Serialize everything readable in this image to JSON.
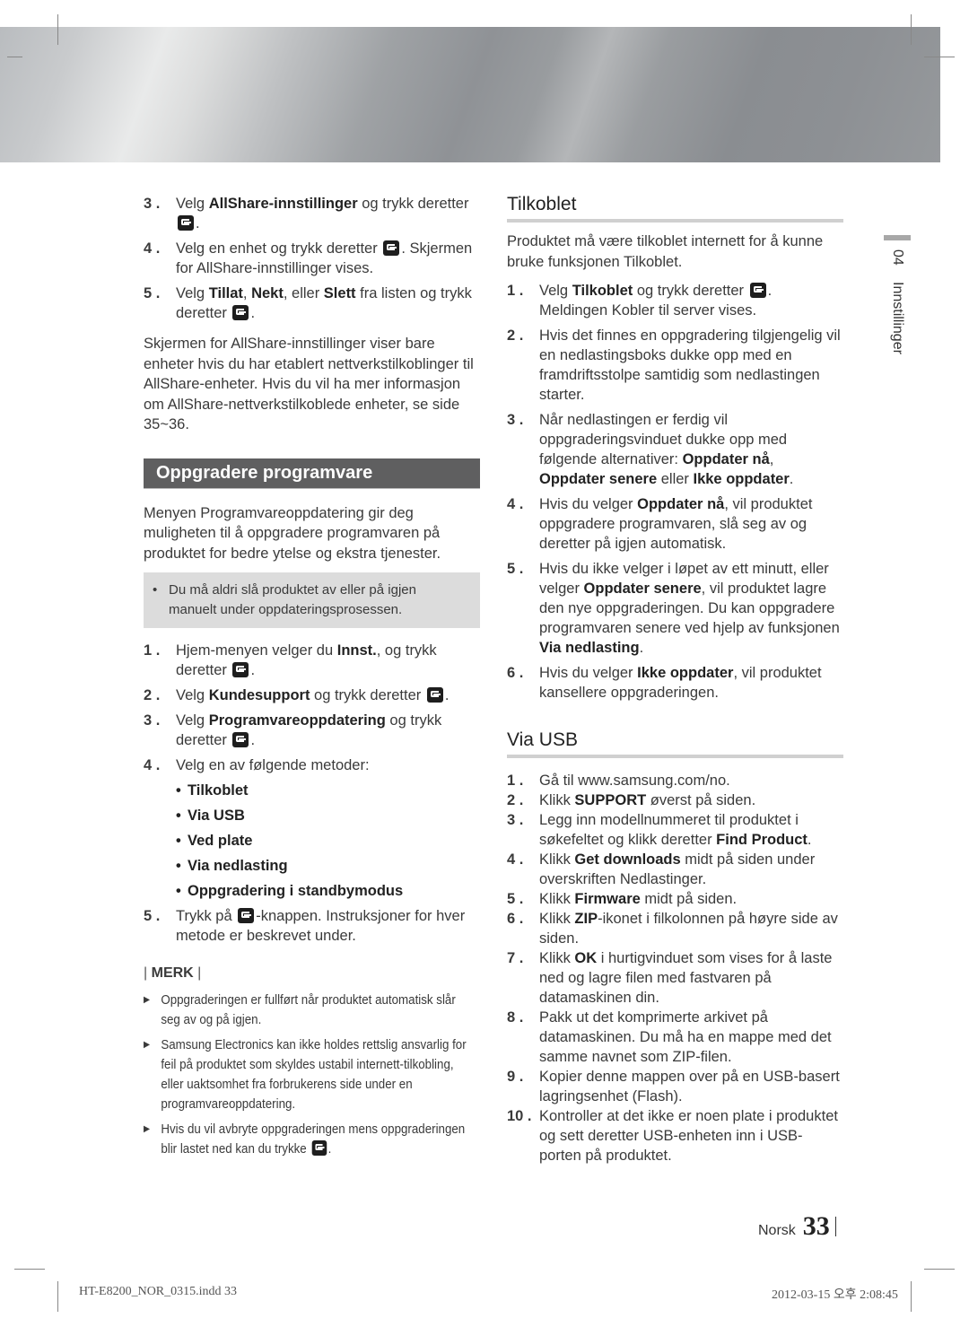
{
  "header": {
    "banner": "silver-gradient-banner"
  },
  "left_column": {
    "intro_steps": [
      {
        "num": "3 .",
        "parts": [
          {
            "t": "Velg "
          },
          {
            "b": "AllShare-innstillinger"
          },
          {
            "t": " og trykk deretter "
          },
          {
            "icon": "enter"
          },
          {
            "t": "."
          }
        ]
      },
      {
        "num": "4 .",
        "parts": [
          {
            "t": "Velg en enhet og trykk deretter "
          },
          {
            "icon": "enter"
          },
          {
            "t": ". Skjermen for AllShare-innstillinger vises."
          }
        ]
      },
      {
        "num": "5 .",
        "parts": [
          {
            "t": "Velg "
          },
          {
            "b": "Tillat"
          },
          {
            "t": ", "
          },
          {
            "b": "Nekt"
          },
          {
            "t": ", eller "
          },
          {
            "b": "Slett"
          },
          {
            "t": "  fra listen og trykk deretter "
          },
          {
            "icon": "enter"
          },
          {
            "t": "."
          }
        ]
      }
    ],
    "allshare_note": "Skjermen for AllShare-innstillinger viser bare enheter hvis du har etablert nettverkstilkoblinger til AllShare-enheter. Hvis du vil ha mer informasjon om AllShare-nettverkstilkoblede enheter, se side 35~36.",
    "section_title": "Oppgradere programvare",
    "section_intro": "Menyen Programvareoppdatering gir deg muligheten til å oppgradere programvaren på produktet for bedre ytelse og ekstra tjenester.",
    "warning": "Du må aldri slå produktet av eller på igjen manuelt under oppdateringsprosessen.",
    "steps": [
      {
        "num": "1 .",
        "parts": [
          {
            "t": "Hjem-menyen velger du "
          },
          {
            "b": "Innst."
          },
          {
            "t": ", og trykk deretter "
          },
          {
            "icon": "enter"
          },
          {
            "t": "."
          }
        ]
      },
      {
        "num": "2 .",
        "parts": [
          {
            "t": "Velg "
          },
          {
            "b": "Kundesupport"
          },
          {
            "t": " og trykk deretter "
          },
          {
            "icon": "enter"
          },
          {
            "t": "."
          }
        ]
      },
      {
        "num": "3 .",
        "parts": [
          {
            "t": "Velg "
          },
          {
            "b": "Programvareoppdatering"
          },
          {
            "t": " og trykk deretter "
          },
          {
            "icon": "enter"
          },
          {
            "t": "."
          }
        ]
      },
      {
        "num": "4 .",
        "parts": [
          {
            "t": "Velg en av følgende metoder:"
          }
        ]
      }
    ],
    "methods": [
      "Tilkoblet",
      "Via USB",
      "Ved plate",
      "Via nedlasting",
      "Oppgradering i standbymodus"
    ],
    "step5": {
      "num": "5 .",
      "parts": [
        {
          "t": "Trykk på "
        },
        {
          "icon": "enter"
        },
        {
          "t": "-knappen. Instruksjoner for hver metode er beskrevet under."
        }
      ]
    },
    "merk_label": "MERK",
    "notes": [
      [
        {
          "t": "Oppgraderingen er fullført når produktet automatisk slår seg av og på igjen."
        }
      ],
      [
        {
          "t": "Samsung Electronics kan ikke holdes rettslig ansvarlig for feil på produktet som skyldes ustabil internett-tilkobling, eller uaktsomhet fra forbrukerens side under en programvareoppdatering."
        }
      ],
      [
        {
          "t": "Hvis du vil avbryte oppgraderingen mens oppgraderingen blir lastet ned kan du trykke "
        },
        {
          "icon": "enter"
        },
        {
          "t": "."
        }
      ]
    ]
  },
  "right_column": {
    "tilkoblet": {
      "title": "Tilkoblet",
      "intro": "Produktet må være tilkoblet internett for å kunne bruke funksjonen Tilkoblet.",
      "steps": [
        {
          "num": "1 .",
          "parts": [
            {
              "t": "Velg "
            },
            {
              "b": "Tilkoblet"
            },
            {
              "t": " og trykk deretter "
            },
            {
              "icon": "enter"
            },
            {
              "t": ". Meldingen Kobler til server vises."
            }
          ]
        },
        {
          "num": "2 .",
          "parts": [
            {
              "t": "Hvis det finnes en oppgradering tilgjengelig vil en nedlastingsboks dukke opp med en framdriftsstolpe samtidig som nedlastingen starter."
            }
          ]
        },
        {
          "num": "3 .",
          "parts": [
            {
              "t": "Når nedlastingen er ferdig vil oppgraderingsvinduet dukke opp med følgende alternativer: "
            },
            {
              "b": "Oppdater nå"
            },
            {
              "t": ", "
            },
            {
              "b": "Oppdater senere"
            },
            {
              "t": " eller "
            },
            {
              "b": "Ikke oppdater"
            },
            {
              "t": "."
            }
          ]
        },
        {
          "num": "4 .",
          "parts": [
            {
              "t": "Hvis du velger "
            },
            {
              "b": "Oppdater nå"
            },
            {
              "t": ", vil produktet oppgradere programvaren, slå seg av og deretter på igjen automatisk."
            }
          ]
        },
        {
          "num": "5 .",
          "parts": [
            {
              "t": "Hvis du ikke velger i løpet av ett minutt, eller velger "
            },
            {
              "b": "Oppdater senere"
            },
            {
              "t": ", vil produktet lagre den nye oppgraderingen. Du kan oppgradere programvaren senere ved hjelp av funksjonen "
            },
            {
              "b": "Via nedlasting"
            },
            {
              "t": "."
            }
          ]
        },
        {
          "num": "6 .",
          "parts": [
            {
              "t": "Hvis du velger "
            },
            {
              "b": "Ikke oppdater"
            },
            {
              "t": ", vil produktet kansellere oppgraderingen."
            }
          ]
        }
      ]
    },
    "via_usb": {
      "title": "Via USB",
      "steps": [
        {
          "num": "1 .",
          "parts": [
            {
              "t": "Gå til www.samsung.com/no."
            }
          ]
        },
        {
          "num": "2 .",
          "parts": [
            {
              "t": "Klikk "
            },
            {
              "b": "SUPPORT"
            },
            {
              "t": " øverst på siden."
            }
          ]
        },
        {
          "num": "3 .",
          "parts": [
            {
              "t": "Legg inn modellnummeret til produktet i søkefeltet og klikk deretter "
            },
            {
              "b": "Find Product"
            },
            {
              "t": "."
            }
          ]
        },
        {
          "num": "4 .",
          "parts": [
            {
              "t": "Klikk "
            },
            {
              "b": "Get downloads"
            },
            {
              "t": " midt på siden under overskriften Nedlastinger."
            }
          ]
        },
        {
          "num": "5 .",
          "parts": [
            {
              "t": "Klikk "
            },
            {
              "b": "Firmware"
            },
            {
              "t": " midt på siden."
            }
          ]
        },
        {
          "num": "6 .",
          "parts": [
            {
              "t": "Klikk "
            },
            {
              "b": "ZIP"
            },
            {
              "t": "-ikonet i filkolonnen på høyre side av siden."
            }
          ]
        },
        {
          "num": "7 .",
          "parts": [
            {
              "t": "Klikk "
            },
            {
              "b": "OK"
            },
            {
              "t": " i hurtigvinduet som vises for å laste ned og lagre filen med fastvaren på datamaskinen din."
            }
          ]
        },
        {
          "num": "8 .",
          "parts": [
            {
              "t": "Pakk ut det komprimerte arkivet på datamaskinen. Du må ha en mappe med det samme navnet som ZIP-filen."
            }
          ]
        },
        {
          "num": "9 .",
          "parts": [
            {
              "t": " Kopier denne mappen over på en USB-basert lagringsenhet (Flash)."
            }
          ]
        },
        {
          "num": "10 .",
          "parts": [
            {
              "t": "Kontroller at det ikke er noen plate i produktet og sett deretter USB-enheten inn i USB-porten på produktet."
            }
          ]
        }
      ]
    }
  },
  "side_tab": {
    "chapter": "04",
    "label": "Innstillinger"
  },
  "footer": {
    "language": "Norsk",
    "page_number": "33"
  },
  "print_slug": {
    "file": "HT-E8200_NOR_0315.indd   33",
    "timestamp": "2012-03-15   오후 2:08:45"
  }
}
